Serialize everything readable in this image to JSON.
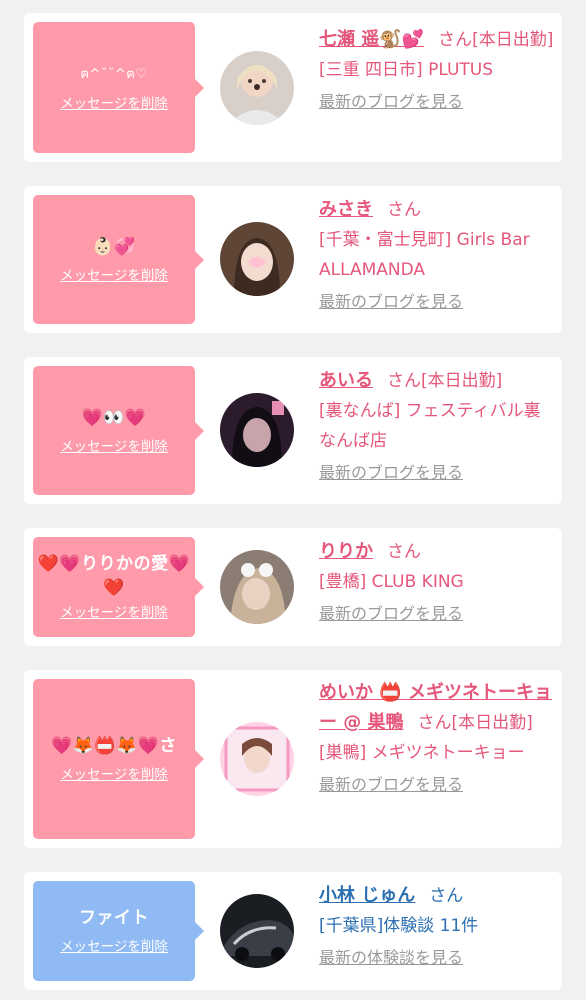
{
  "items": [
    {
      "message": "ฅ^˘˘^ฅ♡",
      "delete_label": "メッセージを削除",
      "name": "七瀬 遥🐒💕",
      "san": "さん",
      "status": "[本日出勤]",
      "location": "[三重 四日市] PLUTUS",
      "blog_label": "最新のブログを見る"
    },
    {
      "message": "👶🏻💞",
      "delete_label": "メッセージを削除",
      "name": "みさき",
      "san": "さん",
      "status": "",
      "location": "[千葉・富士見町] Girls Bar ALLAMANDA",
      "blog_label": "最新のブログを見る"
    },
    {
      "message": "💗👀💗",
      "delete_label": "メッセージを削除",
      "name": "あいる",
      "san": "さん",
      "status": "[本日出勤]",
      "location": "[裏なんば] フェスティバル裏なんば店",
      "blog_label": "最新のブログを見る"
    },
    {
      "message": "❤️💗りりかの愛💗❤️",
      "delete_label": "メッセージを削除",
      "name": "りりか",
      "san": "さん",
      "status": "",
      "location": "[豊橋] CLUB KING",
      "blog_label": "最新のブログを見る"
    },
    {
      "message": "💗🦊📛🦊💗さ",
      "delete_label": "メッセージを削除",
      "name": "めいか 📛 メギツネトーキョー @ 巣鴨",
      "san": "さん",
      "status": "[本日出勤]",
      "location": "[巣鴨] メギツネトーキョー",
      "blog_label": "最新のブログを見る"
    },
    {
      "message": "ファイト",
      "delete_label": "メッセージを削除",
      "name": "小林 じゅん",
      "san": "さん",
      "status": "",
      "location": "[千葉県]体験談 11件",
      "blog_label": "最新の体験談を見る"
    }
  ],
  "colors": {
    "pink_bubble": "#ff9aaa",
    "blue_bubble": "#8fbaf3",
    "pink_text": "#e4577a",
    "blue_text": "#2c6fb2",
    "muted_link": "#999999"
  }
}
